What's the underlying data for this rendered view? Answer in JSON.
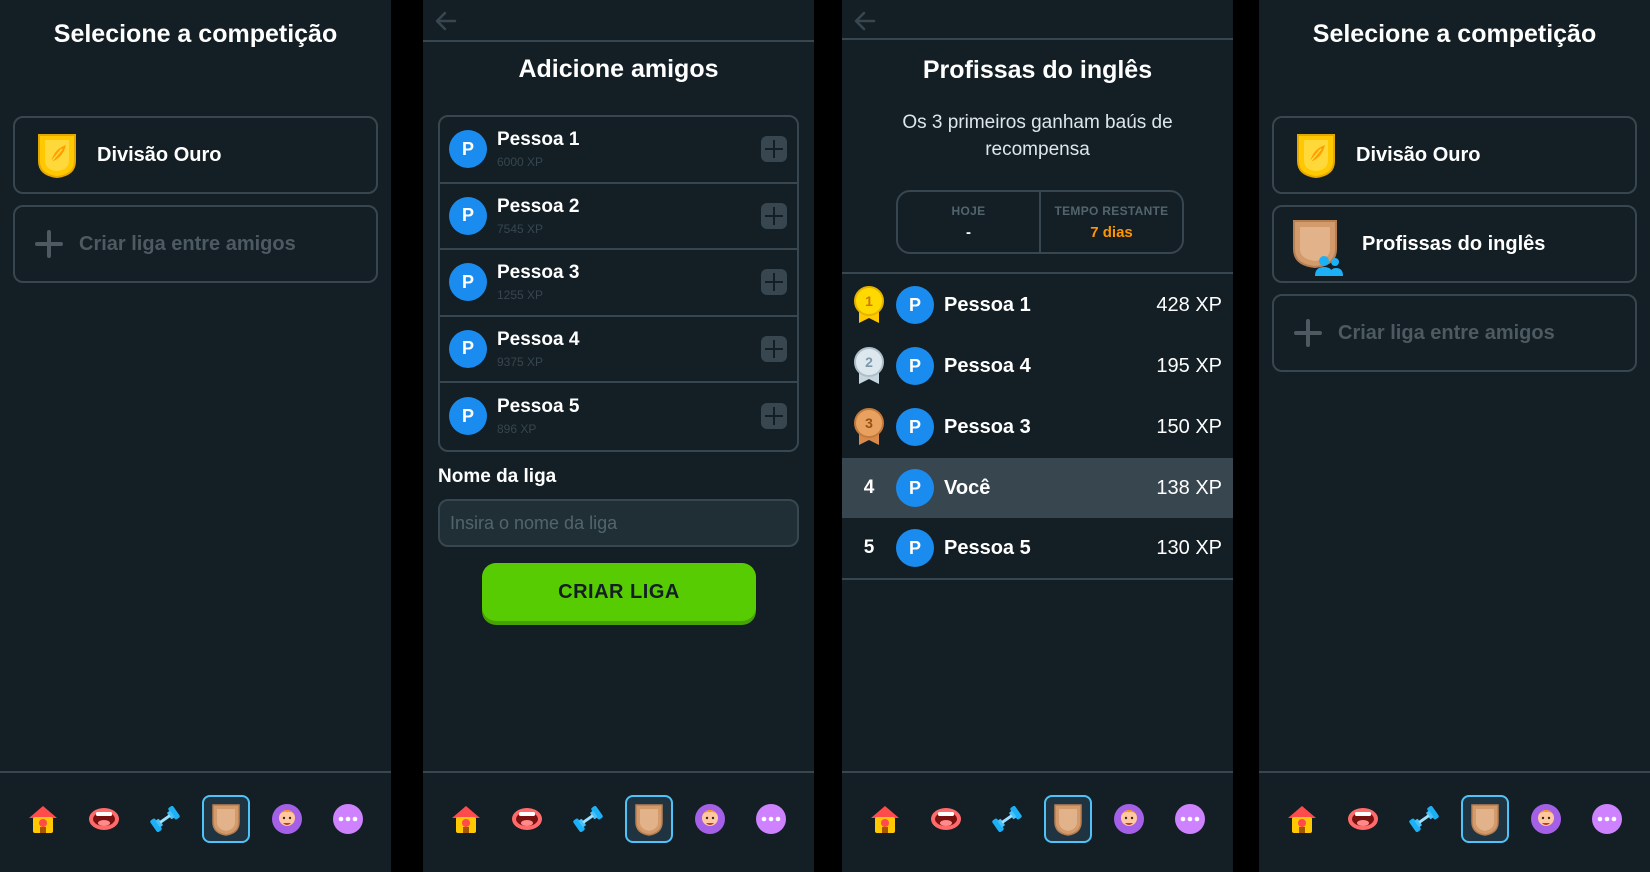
{
  "panel1": {
    "title": "Selecione a competição",
    "leagues": [
      {
        "label": "Divisão Ouro",
        "icon": "gold-shield-icon"
      }
    ],
    "create_label": "Criar liga entre amigos"
  },
  "panel2": {
    "title": "Adicione amigos",
    "friends": [
      {
        "initial": "P",
        "name": "Pessoa 1",
        "xp": "6000 XP"
      },
      {
        "initial": "P",
        "name": "Pessoa 2",
        "xp": "7545 XP"
      },
      {
        "initial": "P",
        "name": "Pessoa 3",
        "xp": "1255 XP"
      },
      {
        "initial": "P",
        "name": "Pessoa 4",
        "xp": "9375 XP"
      },
      {
        "initial": "P",
        "name": "Pessoa 5",
        "xp": "896 XP"
      }
    ],
    "league_name_label": "Nome da liga",
    "league_name_placeholder": "Insira o nome da liga",
    "league_name_value": "",
    "create_button": "CRIAR LIGA"
  },
  "panel3": {
    "title": "Profissas do inglês",
    "subtitle": "Os 3 primeiros ganham baús de recompensa",
    "stats": {
      "today_label": "HOJE",
      "today_value": "-",
      "remaining_label": "TEMPO RESTANTE",
      "remaining_value": "7  dias"
    },
    "ranking": [
      {
        "rank": "1",
        "initial": "P",
        "name": "Pessoa 1",
        "xp": "428 XP",
        "medal": "gold"
      },
      {
        "rank": "2",
        "initial": "P",
        "name": "Pessoa 4",
        "xp": "195 XP",
        "medal": "silver"
      },
      {
        "rank": "3",
        "initial": "P",
        "name": "Pessoa 3",
        "xp": "150 XP",
        "medal": "bronze"
      },
      {
        "rank": "4",
        "initial": "P",
        "name": "Você",
        "xp": "138 XP",
        "medal": ""
      },
      {
        "rank": "5",
        "initial": "P",
        "name": "Pessoa 5",
        "xp": "130 XP",
        "medal": ""
      }
    ]
  },
  "panel4": {
    "title": "Selecione a competição",
    "leagues": [
      {
        "label": "Divisão Ouro",
        "icon": "gold-shield-icon"
      },
      {
        "label": "Profissas do inglês",
        "icon": "bronze-friends-shield-icon"
      }
    ],
    "create_label": "Criar liga entre amigos"
  },
  "nav": {
    "items": [
      "home-icon",
      "speak-icon",
      "practice-icon",
      "leaderboard-icon",
      "profile-icon",
      "more-icon"
    ],
    "active": "leaderboard-icon"
  },
  "colors": {
    "background": "#131f24",
    "border": "#37464f",
    "accent_green": "#58cc02",
    "avatar_blue": "#1a8cf0",
    "orange": "#ff9600"
  }
}
